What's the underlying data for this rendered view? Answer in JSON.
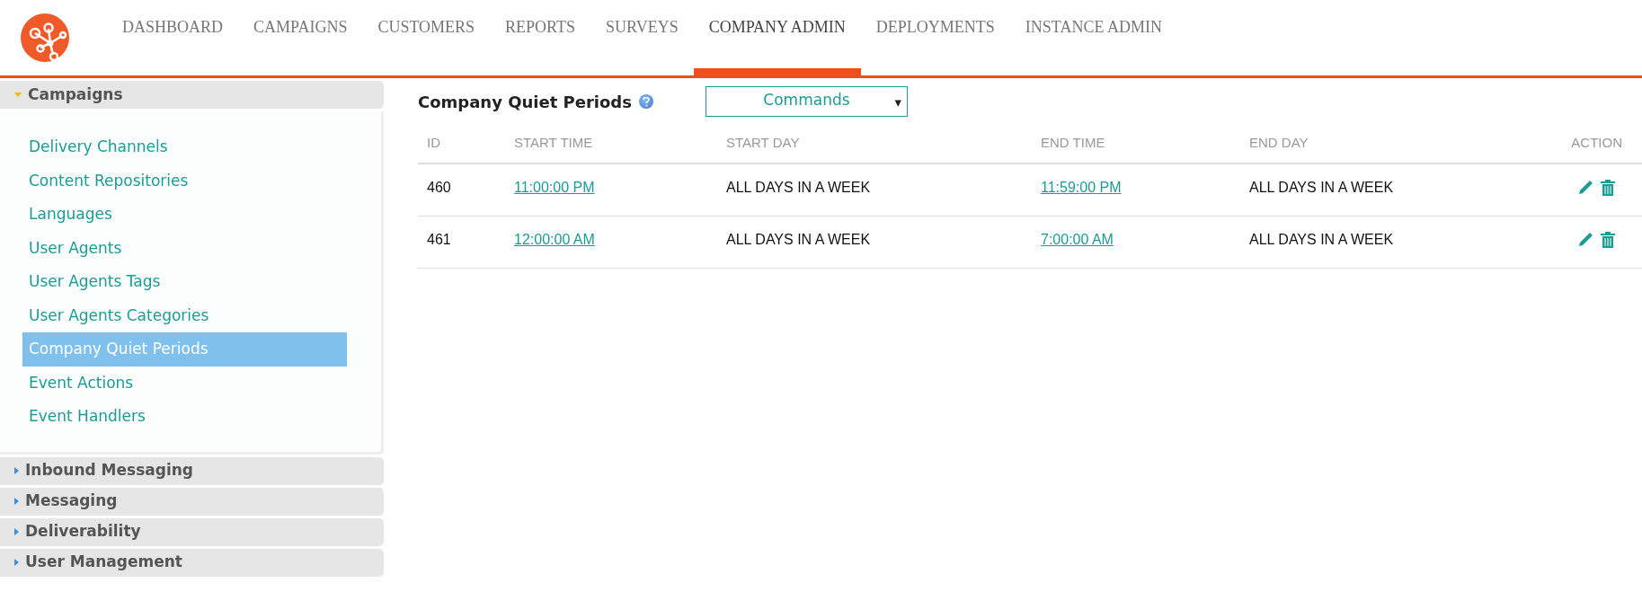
{
  "nav": [
    {
      "label": "DASHBOARD",
      "selected": false
    },
    {
      "label": "CAMPAIGNS",
      "selected": false
    },
    {
      "label": "CUSTOMERS",
      "selected": false
    },
    {
      "label": "REPORTS",
      "selected": false
    },
    {
      "label": "SURVEYS",
      "selected": false
    },
    {
      "label": "COMPANY ADMIN",
      "selected": true
    },
    {
      "label": "DEPLOYMENTS",
      "selected": false
    },
    {
      "label": "INSTANCE ADMIN",
      "selected": false
    }
  ],
  "sidebar": [
    {
      "title": "Campaigns",
      "expanded": true,
      "items": [
        {
          "label": "Delivery Channels",
          "selected": false
        },
        {
          "label": "Content Repositories",
          "selected": false
        },
        {
          "label": "Languages",
          "selected": false
        },
        {
          "label": "User Agents",
          "selected": false
        },
        {
          "label": "User Agents Tags",
          "selected": false
        },
        {
          "label": "User Agents Categories",
          "selected": false
        },
        {
          "label": "Company Quiet Periods",
          "selected": true
        },
        {
          "label": "Event Actions",
          "selected": false
        },
        {
          "label": "Event Handlers",
          "selected": false
        }
      ]
    },
    {
      "title": "Inbound Messaging",
      "expanded": false
    },
    {
      "title": "Messaging",
      "expanded": false
    },
    {
      "title": "Deliverability",
      "expanded": false
    },
    {
      "title": "User Management",
      "expanded": false
    }
  ],
  "page_title": "Company Quiet Periods",
  "commands": {
    "label": "Commands",
    "caret": "▾"
  },
  "table": {
    "columns": [
      "ID",
      "START TIME",
      "START DAY",
      "END TIME",
      "END DAY",
      "ACTION"
    ],
    "rows": [
      {
        "id": "460",
        "start_time": "11:00:00 PM",
        "start_day": "ALL DAYS IN A WEEK",
        "end_time": "11:59:00 PM",
        "end_day": "ALL DAYS IN A WEEK"
      },
      {
        "id": "461",
        "start_time": "12:00:00 AM",
        "start_day": "ALL DAYS IN A WEEK",
        "end_time": "7:00:00 AM",
        "end_day": "ALL DAYS IN A WEEK"
      }
    ]
  }
}
